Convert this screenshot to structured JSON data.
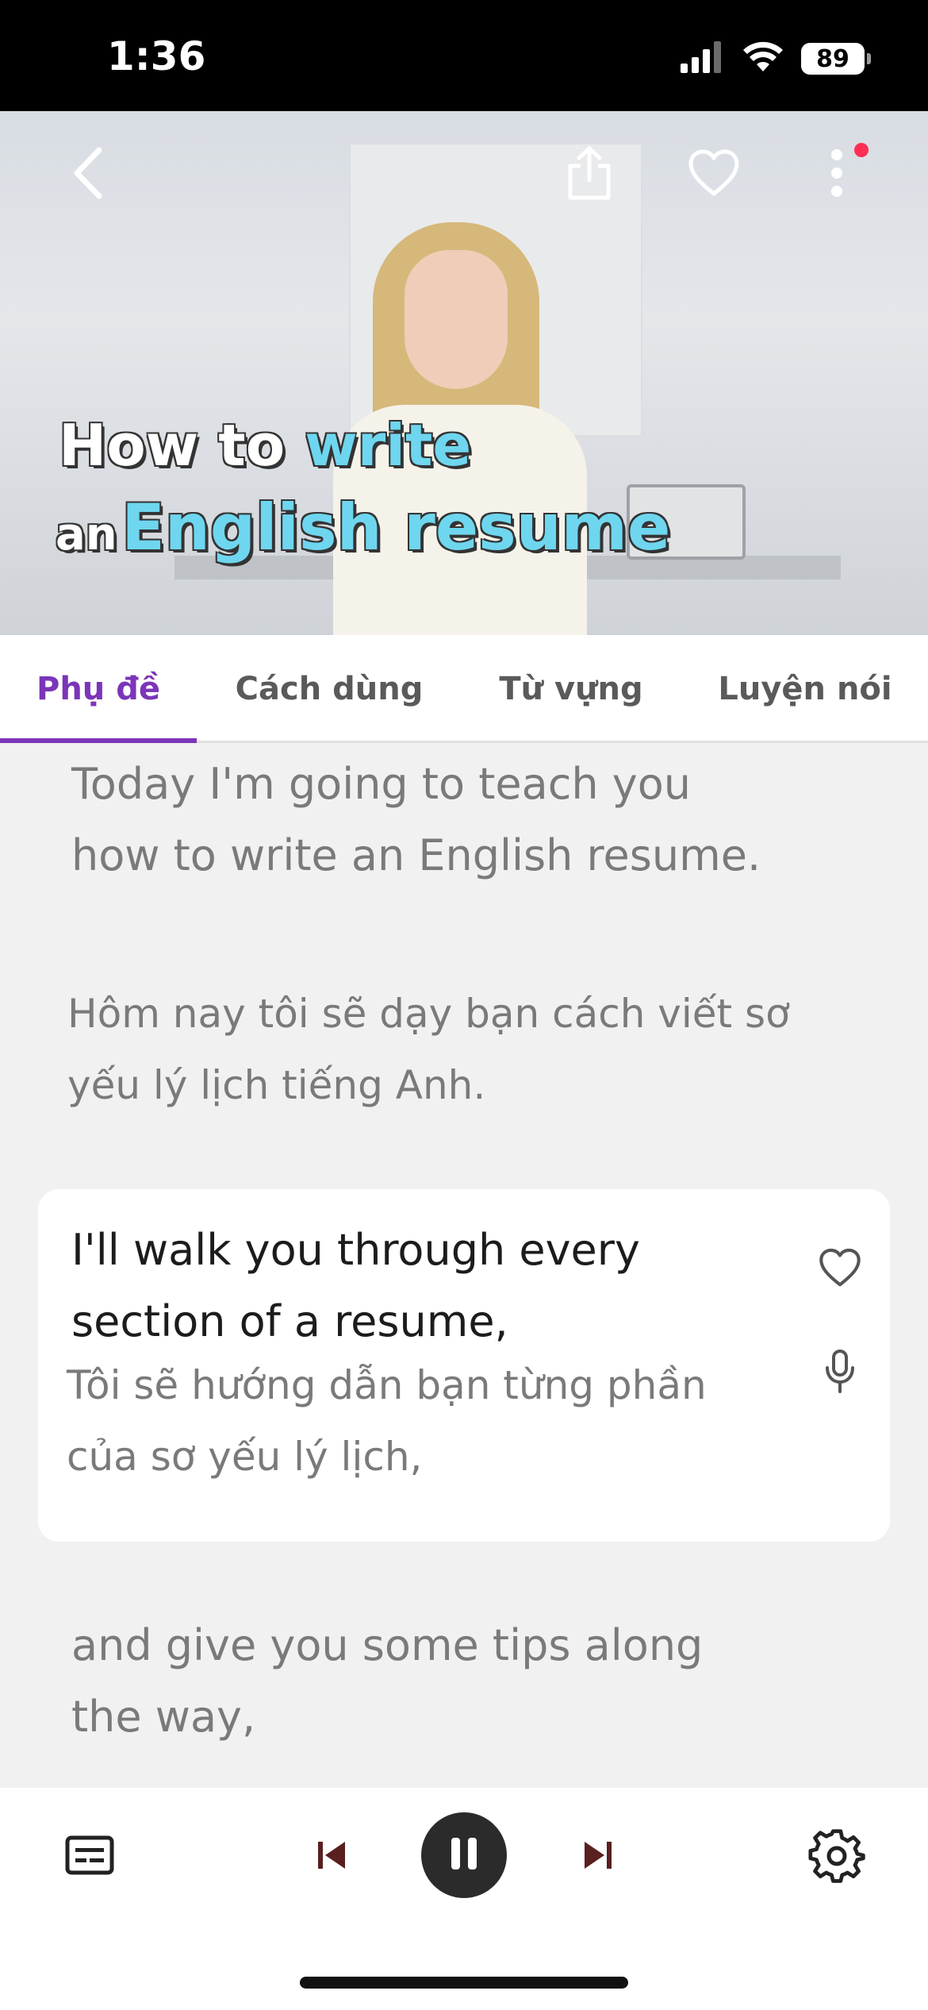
{
  "status_bar": {
    "time": "1:36",
    "battery": "89",
    "icons": [
      "signal-icon",
      "wifi-icon",
      "battery-icon"
    ]
  },
  "video": {
    "title_line1_white": "How to",
    "title_line1_cyan": "write",
    "title_line2_white": "an",
    "title_line2_cyan": "English resume",
    "icons": [
      "back-icon",
      "share-icon",
      "heart-icon",
      "more-icon"
    ]
  },
  "tabs": [
    {
      "label": "Phụ đề",
      "active": true
    },
    {
      "label": "Cách dùng",
      "active": false
    },
    {
      "label": "Từ vựng",
      "active": false
    },
    {
      "label": "Luyện nói",
      "active": false
    }
  ],
  "subtitles": [
    {
      "en": "Today I'm going to teach you how to write an English resume.",
      "vi": "Hôm nay tôi sẽ dạy bạn cách viết sơ yếu lý lịch tiếng Anh.",
      "current": false
    },
    {
      "en": "I'll walk you through every section of a resume,",
      "vi": "Tôi sẽ hướng dẫn bạn từng phần của sơ yếu lý lịch,",
      "current": true
    },
    {
      "en": "and give you some tips along the way,",
      "vi": "",
      "current": false
    }
  ],
  "controls": {
    "icons": [
      "subtitle-icon",
      "previous-icon",
      "pause-icon",
      "next-icon",
      "settings-icon"
    ]
  },
  "colors": {
    "accent": "#7b35b8",
    "title_cyan": "#6fd6ef",
    "notification_dot": "#ff2e55"
  }
}
